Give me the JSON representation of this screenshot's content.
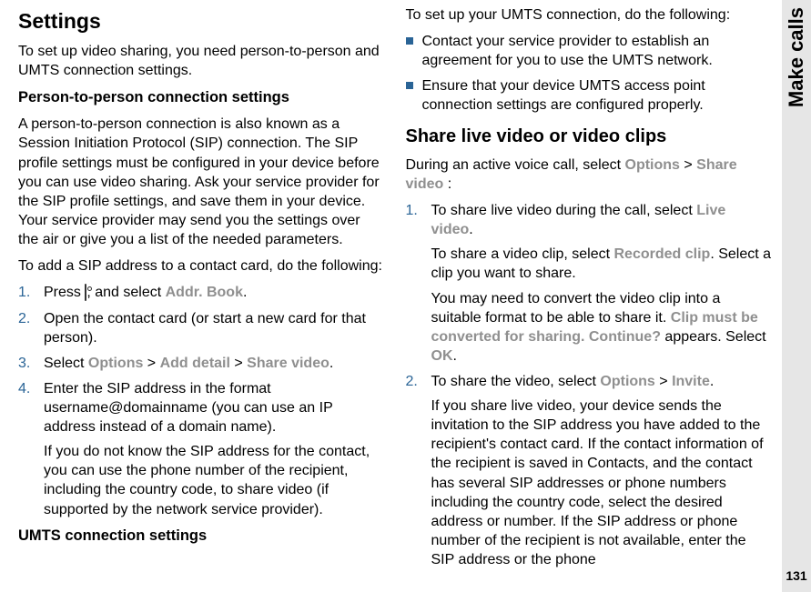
{
  "sidebar": {
    "section_label": "Make calls",
    "page_number": "131"
  },
  "left": {
    "h1": "Settings",
    "intro": "To set up video sharing, you need person-to-person and UMTS connection settings.",
    "subhead1": "Person-to-person connection settings",
    "p2p_para": "A person-to-person connection is also known as a Session Initiation Protocol (SIP) connection. The SIP profile settings must be configured in your device before you can use video sharing. Ask your service provider for the SIP profile settings, and save them in your device. Your service provider may send you the settings over the air or give you a list of the needed parameters.",
    "add_sip_intro": "To add a SIP address to a contact card, do the following:",
    "step1_a": "Press ",
    "step1_b": ", and select ",
    "step1_c": "Addr. Book",
    "step1_d": ".",
    "step2": "Open the contact card (or start a new card for that person).",
    "step3_a": "Select ",
    "step3_opt": "Options",
    "step3_gt1": " > ",
    "step3_add": "Add detail",
    "step3_gt2": " > ",
    "step3_share": "Share video",
    "step3_end": ".",
    "step4_a": "Enter the SIP address in the format username@domainname (you can use an IP address instead of a domain name).",
    "step4_b": "If you do not know the SIP address for the contact, you can use the phone number of the recipient, including the country code, to share video (if supported by the network service provider).",
    "subhead2": "UMTS connection settings"
  },
  "right": {
    "umts_intro": "To set up your UMTS connection, do the following:",
    "bullet1": "Contact your service provider to establish an agreement for you to use the UMTS network.",
    "bullet2": "Ensure that your device UMTS access point connection settings are configured properly.",
    "h2": "Share live video or video clips",
    "share_intro_a": "During an active voice call, select ",
    "share_intro_opt": "Options",
    "share_intro_gt": " > ",
    "share_intro_sv": "Share video",
    "share_intro_end": " :",
    "s1a_a": "To share live video during the call, select ",
    "s1a_live": "Live video",
    "s1a_end": ".",
    "s1b_a": "To share a video clip, select ",
    "s1b_rec": "Recorded clip",
    "s1b_end": ". Select a clip you want to share.",
    "s1c_a": "You may need to convert the video clip into a suitable format to be able to share it. ",
    "s1c_msg": "Clip must be converted for sharing. Continue?",
    "s1c_b": " appears. Select ",
    "s1c_ok": "OK",
    "s1c_end": ".",
    "s2a_a": "To share the video, select ",
    "s2a_opt": "Options",
    "s2a_gt": " > ",
    "s2a_inv": "Invite",
    "s2a_end": ".",
    "s2b": "If you share live video, your device sends the invitation to the SIP address you have added to the recipient's contact card. If the contact information of the recipient is saved in Contacts, and the contact has several SIP addresses or phone numbers including the country code, select the desired address or number. If the SIP address or phone number of the recipient is not available, enter the SIP address or the phone"
  },
  "nums": {
    "n1": "1.",
    "n2": "2.",
    "n3": "3.",
    "n4": "4."
  }
}
